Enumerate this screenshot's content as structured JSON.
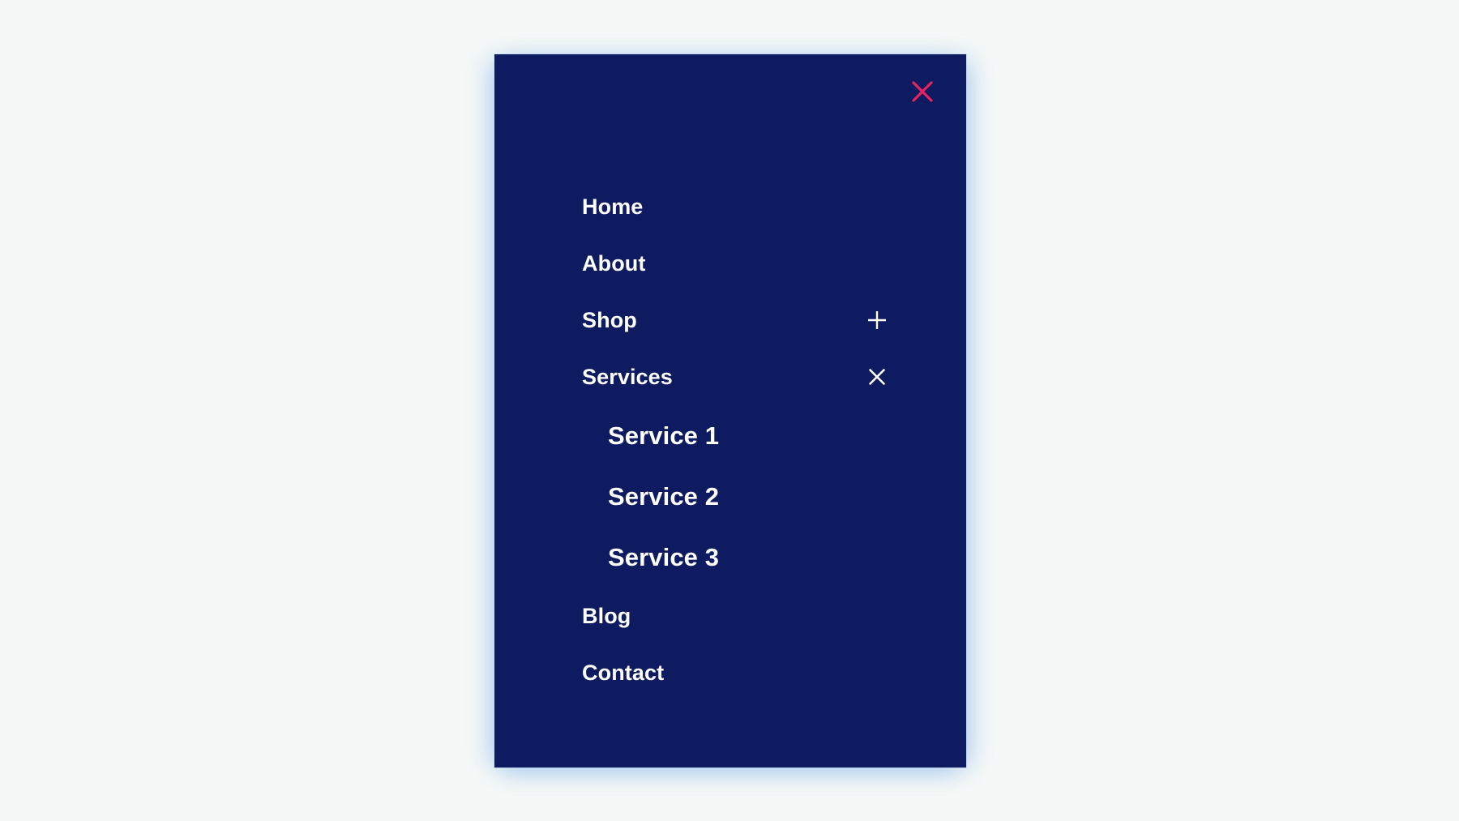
{
  "page": {
    "background_color": "#f4f8f7"
  },
  "nav_panel": {
    "background_color": "#0f1b60",
    "text_color": "#ffffff",
    "close": {
      "icon": "close-icon",
      "label": "Close menu",
      "color": "#e8245e"
    },
    "items": [
      {
        "label": "Home",
        "has_submenu": false,
        "toggle_icon": null,
        "expanded": false
      },
      {
        "label": "About",
        "has_submenu": false,
        "toggle_icon": null,
        "expanded": false
      },
      {
        "label": "Shop",
        "has_submenu": true,
        "toggle_icon": "plus-icon",
        "toggle_color": "#ffffff",
        "expanded": false,
        "submenu": []
      },
      {
        "label": "Services",
        "has_submenu": true,
        "toggle_icon": "close-icon",
        "toggle_color": "#ffffff",
        "expanded": true,
        "submenu": [
          {
            "label": "Service 1"
          },
          {
            "label": "Service 2"
          },
          {
            "label": "Service 3"
          }
        ]
      },
      {
        "label": "Blog",
        "has_submenu": false,
        "toggle_icon": null,
        "expanded": false
      },
      {
        "label": "Contact",
        "has_submenu": false,
        "toggle_icon": null,
        "expanded": false
      }
    ]
  }
}
